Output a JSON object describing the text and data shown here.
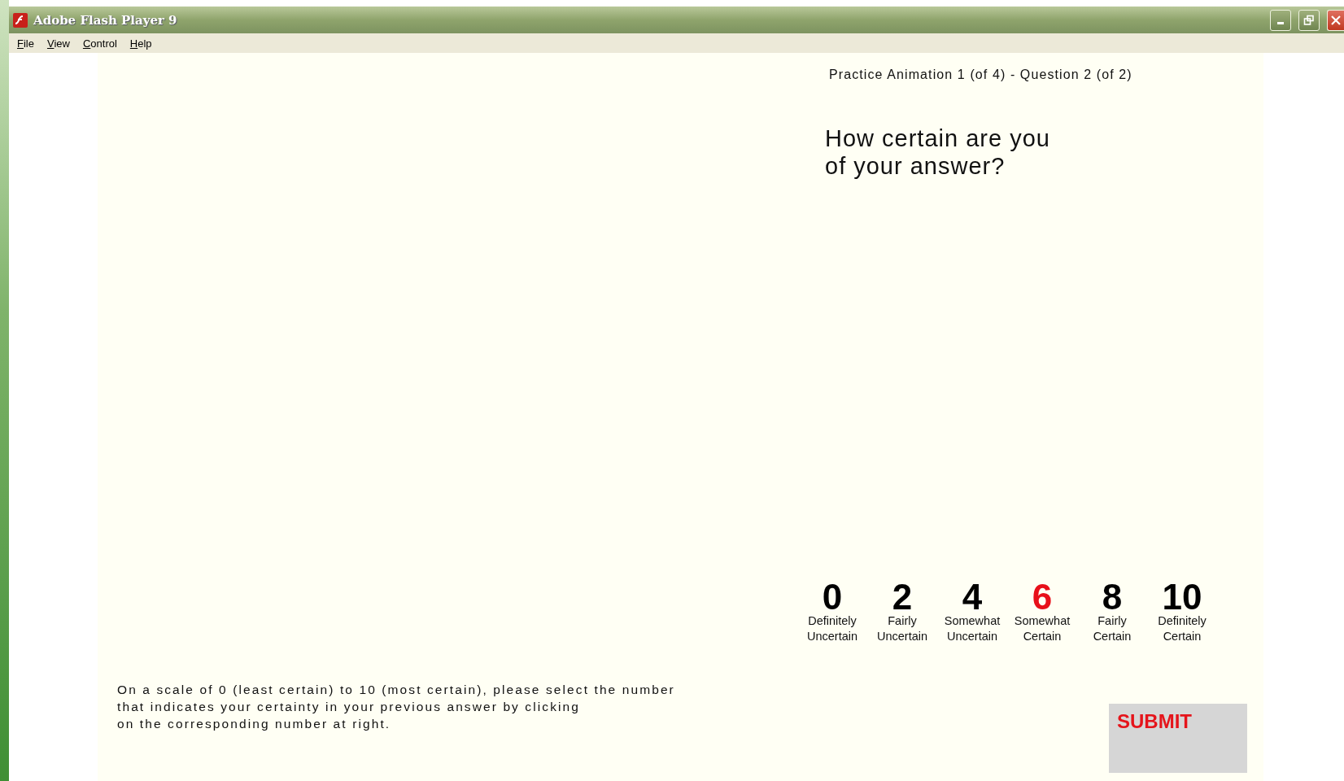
{
  "window": {
    "title": "Adobe Flash Player 9"
  },
  "menu": [
    "File",
    "View",
    "Control",
    "Help"
  ],
  "header": "Practice Animation 1 (of 4) - Question 2 (of 2)",
  "question": "How certain are you of your answer?",
  "scale": [
    {
      "number": "0",
      "label_1": "Definitely",
      "label_2": "Uncertain",
      "selected": false
    },
    {
      "number": "2",
      "label_1": "Fairly",
      "label_2": "Uncertain",
      "selected": false
    },
    {
      "number": "4",
      "label_1": "Somewhat",
      "label_2": "Uncertain",
      "selected": false
    },
    {
      "number": "6",
      "label_1": "Somewhat",
      "label_2": "Certain",
      "selected": true
    },
    {
      "number": "8",
      "label_1": "Fairly",
      "label_2": "Certain",
      "selected": false
    },
    {
      "number": "10",
      "label_1": "Definitely",
      "label_2": "Certain",
      "selected": false
    }
  ],
  "instructions": [
    "On a scale of 0 (least certain) to 10 (most certain), please select the number",
    "that indicates your certainty in your previous answer by clicking",
    "on the corresponding number at right."
  ],
  "submit": "SUBMIT"
}
